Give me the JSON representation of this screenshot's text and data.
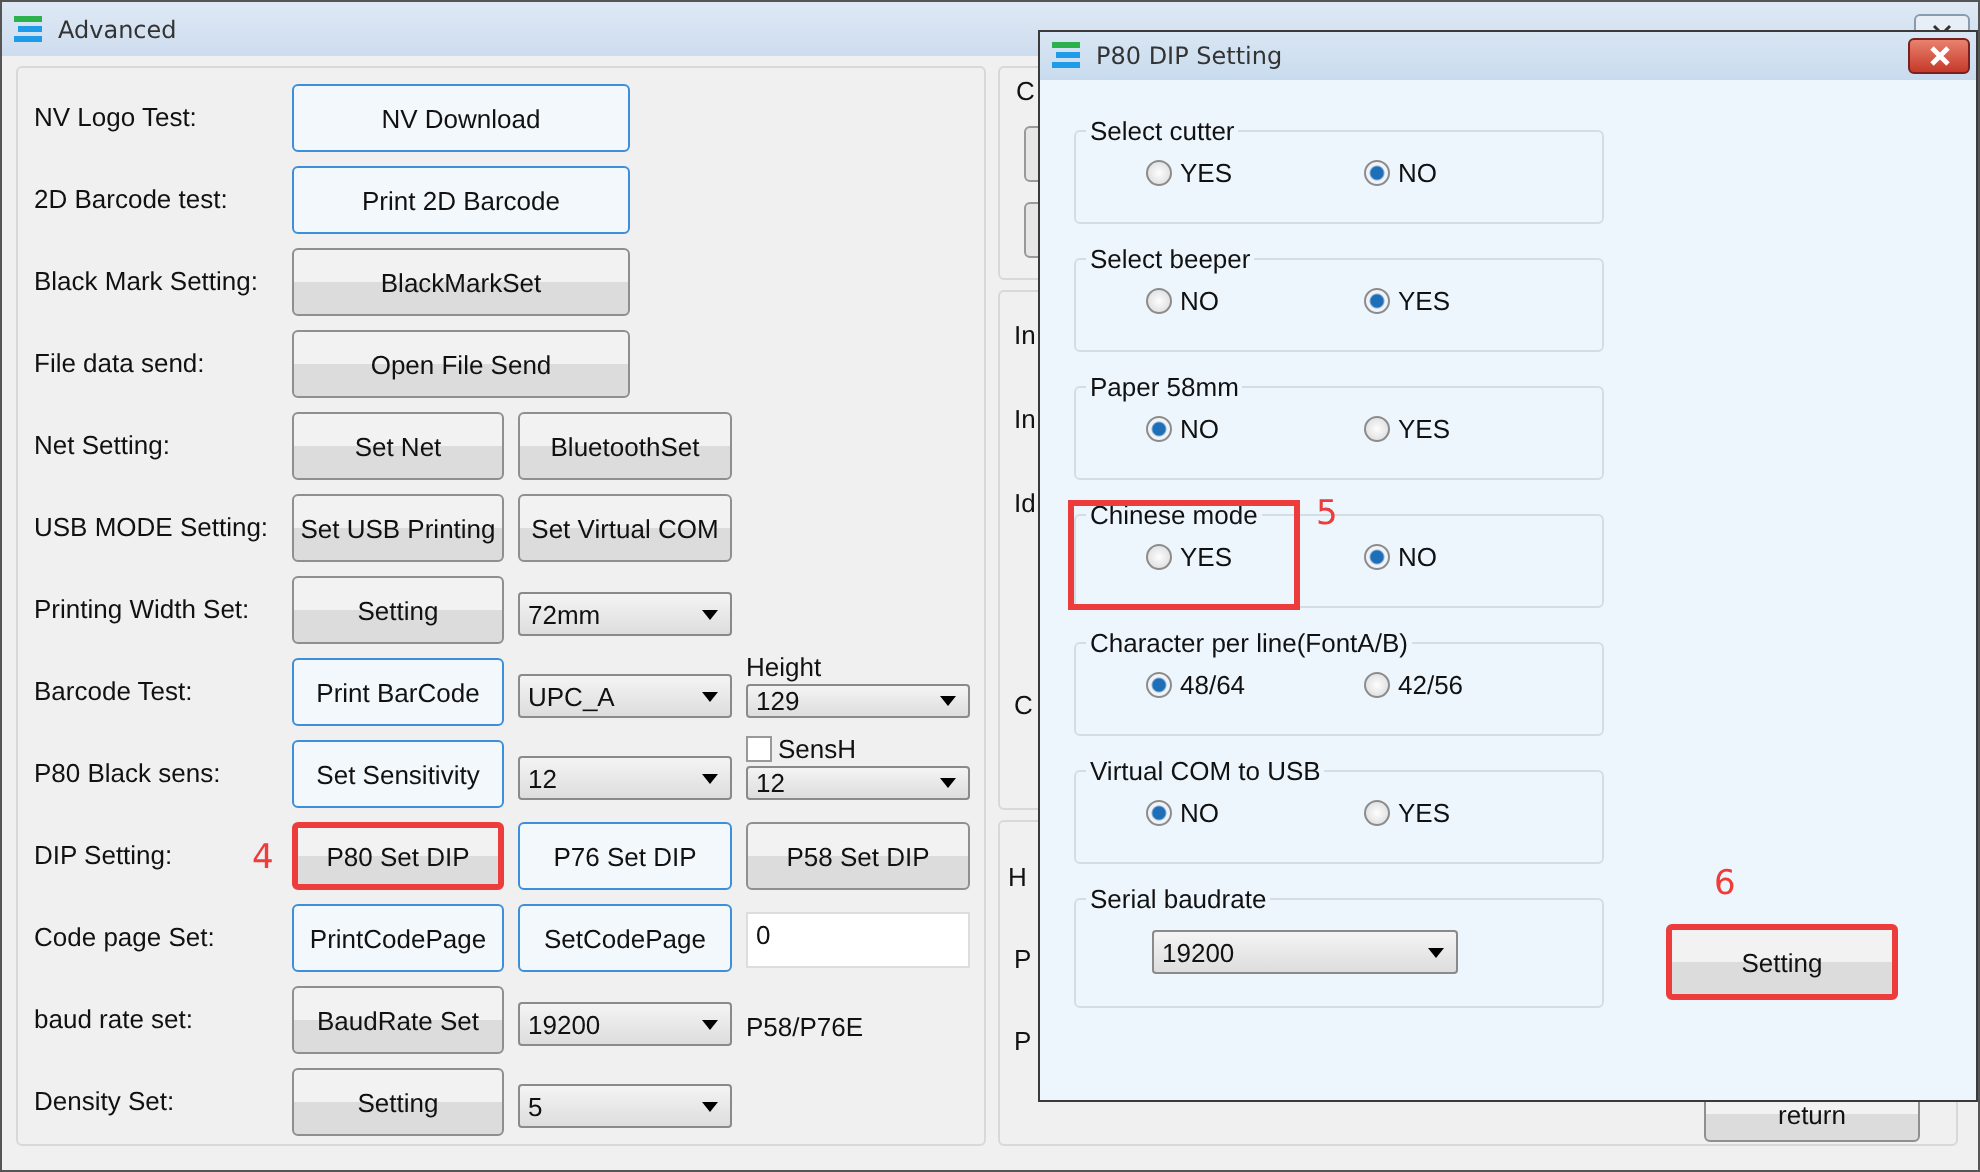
{
  "window": {
    "title": "Advanced"
  },
  "left_panel": {
    "rows": [
      {
        "label": "NV Logo Test:",
        "cells": [
          {
            "kind": "button",
            "label": "NV Download",
            "focused": true
          }
        ]
      },
      {
        "label": "2D Barcode test:",
        "cells": [
          {
            "kind": "button",
            "label": "Print 2D Barcode",
            "focused": true
          }
        ]
      },
      {
        "label": "Black Mark Setting:",
        "cells": [
          {
            "kind": "button",
            "label": "BlackMarkSet",
            "focused": false
          }
        ]
      },
      {
        "label": "File data send:",
        "cells": [
          {
            "kind": "button",
            "label": "Open File Send",
            "focused": false
          }
        ]
      },
      {
        "label": "Net Setting:",
        "cells": [
          {
            "kind": "button",
            "label": "Set Net",
            "focused": false
          },
          {
            "kind": "button",
            "label": "BluetoothSet",
            "focused": false
          }
        ]
      },
      {
        "label": "USB MODE Setting:",
        "cells": [
          {
            "kind": "button",
            "label": "Set USB Printing",
            "focused": false
          },
          {
            "kind": "button",
            "label": "Set Virtual COM",
            "focused": false
          }
        ]
      },
      {
        "label": "Printing Width Set:",
        "cells": [
          {
            "kind": "button",
            "label": "Setting",
            "focused": false
          },
          {
            "kind": "select",
            "value": "72mm"
          }
        ]
      },
      {
        "label": "Barcode Test:",
        "cells": [
          {
            "kind": "button",
            "label": "Print BarCode",
            "focused": true
          },
          {
            "kind": "select",
            "value": "UPC_A"
          },
          {
            "kind": "select",
            "value": "129",
            "caption": "Height"
          }
        ]
      },
      {
        "label": "P80 Black sens:",
        "cells": [
          {
            "kind": "button",
            "label": "Set Sensitivity",
            "focused": true
          },
          {
            "kind": "select",
            "value": "12"
          },
          {
            "kind": "select",
            "value": "12",
            "checkbox": {
              "label": "SensH",
              "checked": false
            }
          }
        ]
      },
      {
        "label": "DIP Setting:",
        "cells": [
          {
            "kind": "button",
            "label": "P80 Set DIP",
            "focused": false,
            "callout": "4"
          },
          {
            "kind": "button",
            "label": "P76 Set DIP",
            "focused": true
          },
          {
            "kind": "button",
            "label": "P58 Set DIP",
            "focused": false
          }
        ]
      },
      {
        "label": "Code page Set:",
        "cells": [
          {
            "kind": "button",
            "label": "PrintCodePage",
            "focused": true
          },
          {
            "kind": "button",
            "label": "SetCodePage",
            "focused": true
          },
          {
            "kind": "input",
            "value": "0"
          }
        ]
      },
      {
        "label": "baud rate set:",
        "cells": [
          {
            "kind": "button",
            "label": "BaudRate Set",
            "focused": false
          },
          {
            "kind": "select",
            "value": "19200"
          },
          {
            "kind": "text",
            "text": "P58/P76E"
          }
        ]
      },
      {
        "label": "Density Set:",
        "cells": [
          {
            "kind": "button",
            "label": "Setting",
            "focused": false
          },
          {
            "kind": "select",
            "value": "5"
          }
        ]
      }
    ]
  },
  "right_panel": {
    "top_title": "C",
    "middle_labels": [
      "In",
      "In",
      "Id",
      "C"
    ],
    "bottom_labels": [
      "H",
      "P",
      "P"
    ],
    "return_button": "return"
  },
  "dialog": {
    "title": "P80 DIP Setting",
    "groups": [
      {
        "title": "Select cutter",
        "kind": "radios",
        "options": [
          {
            "label": "YES",
            "selected": false
          },
          {
            "label": "NO",
            "selected": true
          }
        ]
      },
      {
        "title": "Select beeper",
        "kind": "radios",
        "options": [
          {
            "label": "NO",
            "selected": false
          },
          {
            "label": "YES",
            "selected": true
          }
        ]
      },
      {
        "title": "Paper 58mm",
        "kind": "radios",
        "options": [
          {
            "label": "NO",
            "selected": true
          },
          {
            "label": "YES",
            "selected": false
          }
        ]
      },
      {
        "title": "Chinese mode",
        "kind": "radios",
        "callout": "5",
        "options": [
          {
            "label": "YES",
            "selected": false
          },
          {
            "label": "NO",
            "selected": true
          }
        ]
      },
      {
        "title": "Character per line(FontA/B)",
        "kind": "radios",
        "options": [
          {
            "label": "48/64",
            "selected": true
          },
          {
            "label": "42/56",
            "selected": false
          }
        ]
      },
      {
        "title": "Virtual COM to USB",
        "kind": "radios",
        "options": [
          {
            "label": "NO",
            "selected": true
          },
          {
            "label": "YES",
            "selected": false
          }
        ]
      },
      {
        "title": "Serial baudrate",
        "kind": "select",
        "value": "19200"
      }
    ],
    "setting_button": {
      "label": "Setting",
      "callout": "6"
    }
  }
}
